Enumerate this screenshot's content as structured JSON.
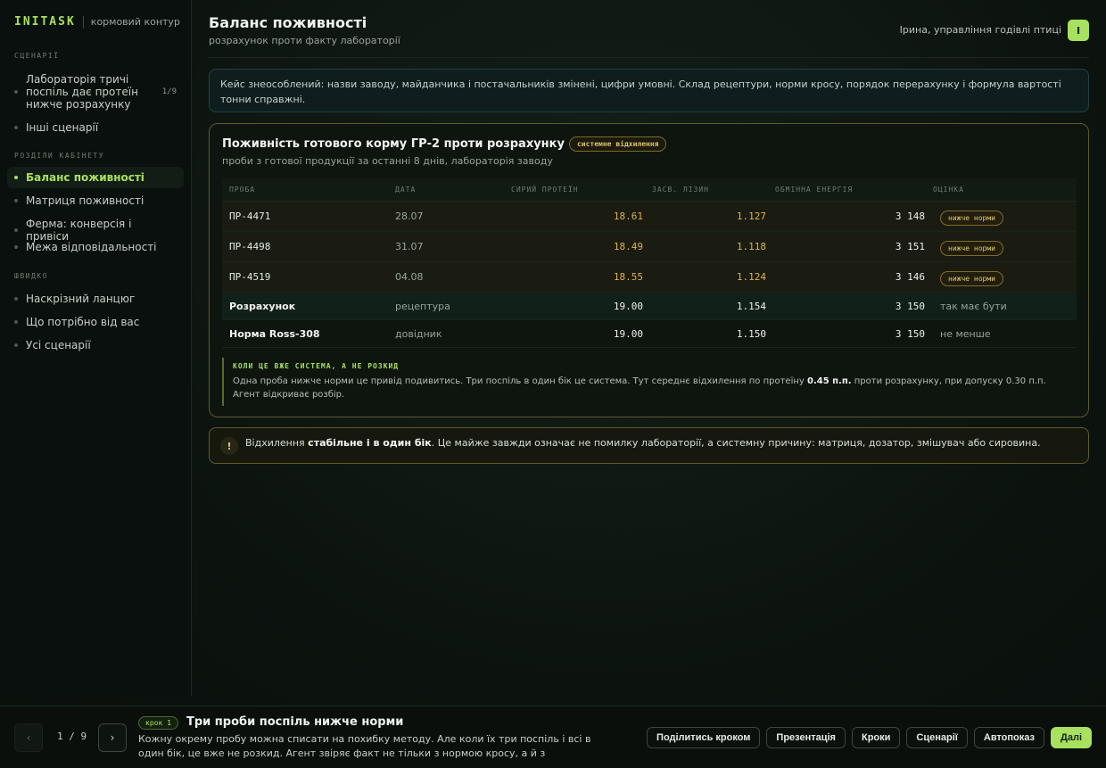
{
  "brand": {
    "name": "INITASK",
    "subtitle": "кормовий контур"
  },
  "sidebar": {
    "scenarios_title": "СЦЕНАРІЇ",
    "scenarios": [
      {
        "label": "Лабораторія тричі поспіль дає протеїн нижче розрахунку",
        "count": "1/9"
      },
      {
        "label": "Інші сценарії"
      }
    ],
    "sections_title": "РОЗДІЛИ КАБІНЕТУ",
    "sections": [
      {
        "label": "Баланс поживності"
      },
      {
        "label": "Матриця поживності"
      },
      {
        "label": "Ферма: конверсія і привіси"
      },
      {
        "label": "Межа відповідальності"
      }
    ],
    "quick_title": "ШВИДКО",
    "quick": [
      {
        "label": "Наскрізний ланцюг"
      },
      {
        "label": "Що потрібно від вас"
      },
      {
        "label": "Усі сценарії"
      }
    ]
  },
  "header": {
    "title": "Баланс поживності",
    "subtitle": "розрахунок проти факту лабораторії",
    "user": "Ірина, управління годівлі птиці",
    "avatar": "I"
  },
  "notice": "Кейс знеособлений: назви заводу, майданчика і постачальників змінені, цифри умовні. Склад рецептури, норми кросу, порядок перерахунку і формула вартості тонни справжні.",
  "card": {
    "title": "Поживність готового корму ГР-2 проти розрахунку",
    "badge": "системне відхилення",
    "subtitle": "проби з готової продукції за останні 8 днів, лабораторія заводу",
    "columns": [
      "ПРОБА",
      "ДАТА",
      "СИРИЙ ПРОТЕЇН",
      "ЗАСВ. ЛІЗИН",
      "ОБМІННА ЕНЕРГІЯ",
      "ОЦІНКА"
    ],
    "rows": [
      {
        "sample": "ПР-4471",
        "date": "28.07",
        "protein": "18.61",
        "lysine": "1.127",
        "energy": "3 148",
        "grade": "нижче норми"
      },
      {
        "sample": "ПР-4498",
        "date": "31.07",
        "protein": "18.49",
        "lysine": "1.118",
        "energy": "3 151",
        "grade": "нижче норми"
      },
      {
        "sample": "ПР-4519",
        "date": "04.08",
        "protein": "18.55",
        "lysine": "1.124",
        "energy": "3 146",
        "grade": "нижче норми"
      }
    ],
    "calc": {
      "sample": "Розрахунок",
      "date": "рецептура",
      "protein": "19.00",
      "lysine": "1.154",
      "energy": "3 150",
      "grade": "так має бути"
    },
    "norm": {
      "sample": "Норма Ross-308",
      "date": "довідник",
      "protein": "19.00",
      "lysine": "1.150",
      "energy": "3 150",
      "grade": "не менше"
    },
    "callout": {
      "title": "КОЛИ ЦЕ ВЖЕ СИСТЕМА, А НЕ РОЗКИД",
      "text_before": "Одна проба нижче норми це привід подивитись. Три поспіль в один бік це система. Тут середнє відхилення по протеїну ",
      "text_bold": "0.45 п.п.",
      "text_after": " проти розрахунку, при допуску 0.30 п.п. Агент відкриває розбір."
    }
  },
  "alert": {
    "icon": "!",
    "text_before": "Відхилення ",
    "text_bold": "стабільне і в один бік",
    "text_after": ". Це майже завжди означає не помилку лабораторії, а системну причину: матриця, дозатор, змішувач або сировина."
  },
  "footer": {
    "prev": "‹",
    "next": "›",
    "counter": "1 / 9",
    "step_badge": "крок 1",
    "step_title": "Три проби поспіль нижче норми",
    "step_desc": "Кожну окрему пробу можна списати на похибку методу. Але коли їх три поспіль і всі в один бік, це вже не розкид. Агент звіряє факт не тільки з нормою кросу, а й з розрахунк…",
    "actions": [
      "Поділитись кроком",
      "Презентація",
      "Кроки",
      "Сценарії",
      "Автопоказ",
      "Далі"
    ]
  },
  "colors": {
    "accent": "#a8e05f",
    "warning": "#e0b34a",
    "background": "#0b110e"
  }
}
